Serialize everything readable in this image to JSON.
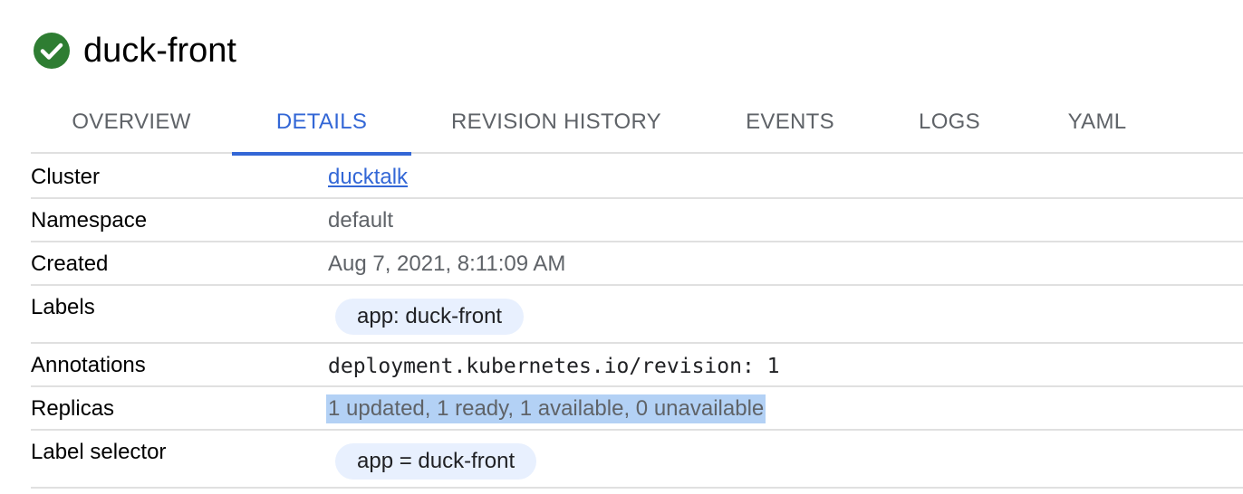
{
  "header": {
    "title": "duck-front",
    "status_icon": "check-circle-icon",
    "status_color": "#34a853"
  },
  "tabs": [
    {
      "label": "OVERVIEW",
      "active": false
    },
    {
      "label": "DETAILS",
      "active": true
    },
    {
      "label": "REVISION HISTORY",
      "active": false
    },
    {
      "label": "EVENTS",
      "active": false
    },
    {
      "label": "LOGS",
      "active": false
    },
    {
      "label": "YAML",
      "active": false
    }
  ],
  "details": {
    "cluster": {
      "key": "Cluster",
      "value": "ducktalk"
    },
    "namespace": {
      "key": "Namespace",
      "value": "default"
    },
    "created": {
      "key": "Created",
      "value": "Aug 7, 2021, 8:11:09 AM"
    },
    "labels": {
      "key": "Labels",
      "value": "app: duck-front"
    },
    "annotations": {
      "key": "Annotations",
      "value": "deployment.kubernetes.io/revision: 1"
    },
    "replicas": {
      "key": "Replicas",
      "value": "1 updated, 1 ready, 1 available, 0 unavailable"
    },
    "label_selector": {
      "key": "Label selector",
      "value": "app = duck-front"
    }
  },
  "colors": {
    "accent": "#3367d6",
    "chip_bg": "#e8f0fe",
    "selection": "#b3d1f5"
  }
}
